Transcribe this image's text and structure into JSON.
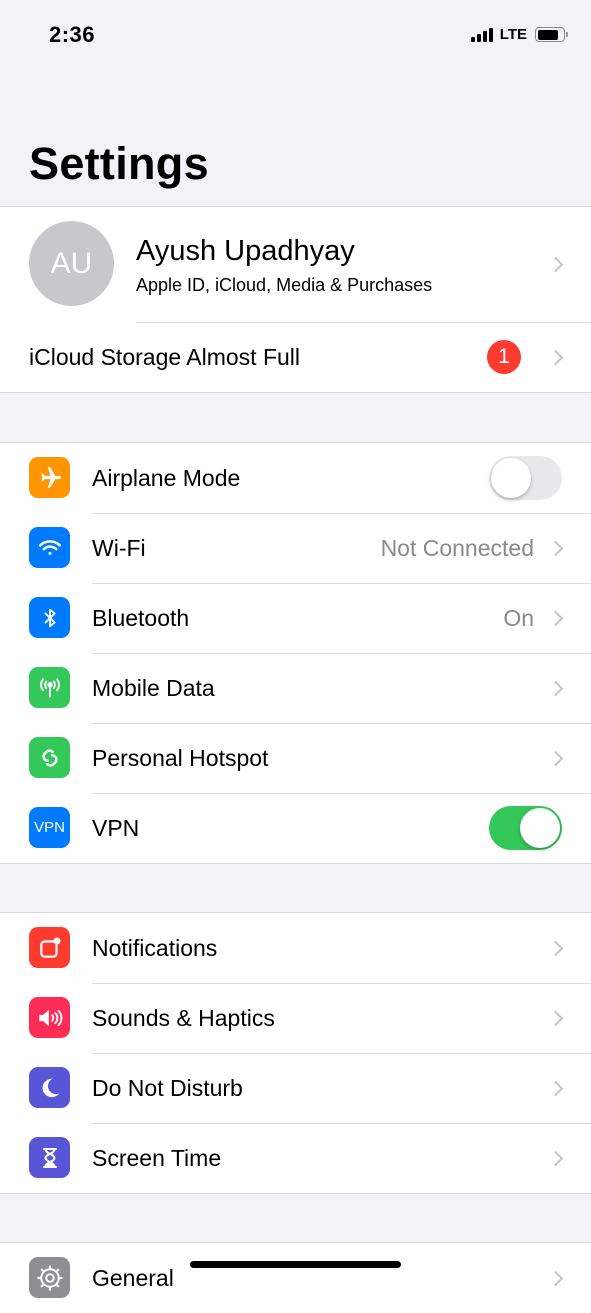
{
  "status_bar": {
    "time": "2:36",
    "network": "LTE",
    "signal_bars": 4,
    "battery_level_percent": 80
  },
  "page": {
    "title": "Settings"
  },
  "profile": {
    "initials": "AU",
    "name": "Ayush Upadhyay",
    "subtitle": "Apple ID, iCloud, Media & Purchases",
    "alert": {
      "label": "iCloud Storage Almost Full",
      "badge": "1"
    }
  },
  "connectivity": [
    {
      "id": "airplane-mode",
      "label": "Airplane Mode",
      "icon": "airplane-icon",
      "color": "#ff9500",
      "control": "toggle",
      "on": false
    },
    {
      "id": "wifi",
      "label": "Wi-Fi",
      "icon": "wifi-icon",
      "color": "#007aff",
      "control": "chevron",
      "value": "Not Connected"
    },
    {
      "id": "bluetooth",
      "label": "Bluetooth",
      "icon": "bluetooth-icon",
      "color": "#007aff",
      "control": "chevron",
      "value": "On"
    },
    {
      "id": "mobile-data",
      "label": "Mobile Data",
      "icon": "antenna-icon",
      "color": "#34c759",
      "control": "chevron"
    },
    {
      "id": "personal-hotspot",
      "label": "Personal Hotspot",
      "icon": "hotspot-link-icon",
      "color": "#34c759",
      "control": "chevron"
    },
    {
      "id": "vpn",
      "label": "VPN",
      "icon": "vpn-icon",
      "icon_text": "VPN",
      "color": "#007aff",
      "control": "toggle",
      "on": true
    }
  ],
  "notifications_group": [
    {
      "id": "notifications",
      "label": "Notifications",
      "icon": "notifications-icon",
      "color": "#ff3b30"
    },
    {
      "id": "sounds-haptics",
      "label": "Sounds & Haptics",
      "icon": "speaker-icon",
      "color": "#ff2d55"
    },
    {
      "id": "do-not-disturb",
      "label": "Do Not Disturb",
      "icon": "moon-icon",
      "color": "#5856d6"
    },
    {
      "id": "screen-time",
      "label": "Screen Time",
      "icon": "hourglass-icon",
      "color": "#5856d6"
    }
  ],
  "general_group": [
    {
      "id": "general",
      "label": "General",
      "icon": "gear-icon",
      "color": "#8e8e93"
    }
  ]
}
